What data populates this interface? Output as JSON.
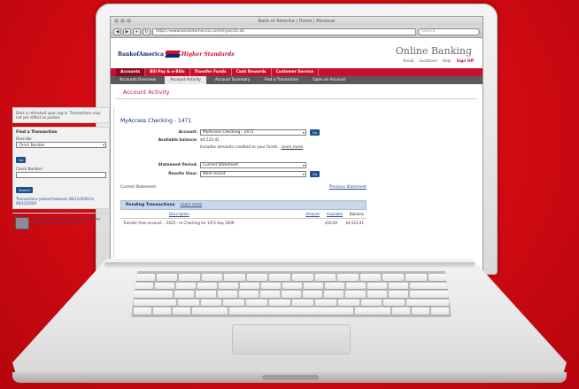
{
  "browser": {
    "window_title": "Bank of America | Home | Personal",
    "url": "https://www.bankofamerica.com/myaccts.do",
    "search_placeholder": "Search",
    "nav_buttons": [
      "◀",
      "▶",
      "+",
      "↻"
    ]
  },
  "header": {
    "logo_text": "BankofAmerica",
    "logo_tagline": "Higher Standards",
    "product_title": "Online Banking",
    "util_links": [
      "Email",
      "Locations",
      "Help",
      "Sign Off"
    ]
  },
  "nav": {
    "main_tabs": [
      "Accounts",
      "Bill Pay & e-Bills",
      "Transfer Funds",
      "Cash Rewards",
      "Customer Service"
    ],
    "active_main": 0,
    "sub_tabs": [
      "Accounts Overview",
      "Account Activity",
      "Account Summary",
      "Find a Transaction",
      "Open an Account"
    ],
    "active_sub": 1
  },
  "page": {
    "title": "Account Activity"
  },
  "sidebar": {
    "note": "Data is refreshed upon log-in. Transactions may not yet reflect as posted.",
    "find_heading": "Find a Transaction",
    "describe_label": "Describe",
    "describe_value": "Check Number",
    "go_label": "Go",
    "check_label": "Check Number:",
    "search_label": "Search",
    "date_range": "Transactions posted between 08/12/2009 to 09/12/2009",
    "promo_text": "Add an Online Alert to keep track of your account balances. Set up Alerts"
  },
  "main": {
    "account_title": "MyAccess Checking - 1471",
    "account_label": "Account:",
    "account_value": "MyAccess Checking - 1471",
    "available_label": "Available balance:",
    "available_value": "$4,523.41",
    "available_note": "Includes amounts credited to your funds.",
    "available_link": "Learn more",
    "statement_label": "Statement Period:",
    "statement_value": "Current Statement",
    "results_label": "Results View:",
    "results_value": "Most recent",
    "go_label": "Go",
    "current_statement_link": "Current Statement",
    "previous_link": "Previous Statement",
    "pending_title": "Pending Transactions",
    "pending_link": "Learn more",
    "columns": [
      "Description",
      "Amount",
      "Available",
      "Balance"
    ],
    "transactions": [
      {
        "description": "Transfer from account ...5025 - to Checking for 1471 Exp 2009",
        "amount": "$50.00",
        "balance": "$4,523.41"
      }
    ]
  }
}
